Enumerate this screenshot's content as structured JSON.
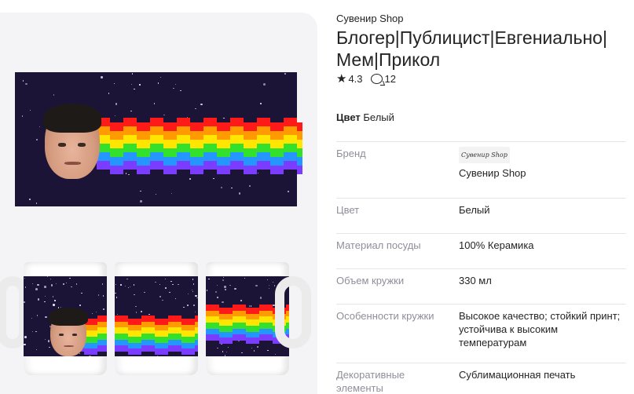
{
  "product": {
    "shop_name": "Сувенир Shop",
    "title": "Блогер|Публицист|Евгениально|\nМем|Прикол",
    "rating": "4.3",
    "reviews_count": "12",
    "color_label": "Цвет",
    "color_value": "Белый"
  },
  "specs": [
    {
      "key": "Бренд",
      "value": "Сувенир Shop",
      "logo_text": "Сувенир Shop"
    },
    {
      "key": "Цвет",
      "value": "Белый"
    },
    {
      "key": "Материал посуды",
      "value": "100% Керамика"
    },
    {
      "key": "Объем кружки",
      "value": "330 мл"
    },
    {
      "key": "Особенности кружки",
      "value": "Высокое качество; стойкий принт; устойчива к высоким температурам"
    },
    {
      "key": "Декоративные элементы",
      "value": "Сублимационная печать"
    }
  ],
  "colors": {
    "accent_text": "#242424",
    "muted_text": "#8f8f9b",
    "gallery_bg": "#f4f4f6",
    "print_bg": "#1b1436",
    "rainbow": [
      "#ff1a1a",
      "#ff9a00",
      "#ffe600",
      "#33e02b",
      "#2596ff",
      "#7a3cff"
    ]
  },
  "icons": {
    "rating": "star-icon",
    "reviews": "comment-icon"
  }
}
